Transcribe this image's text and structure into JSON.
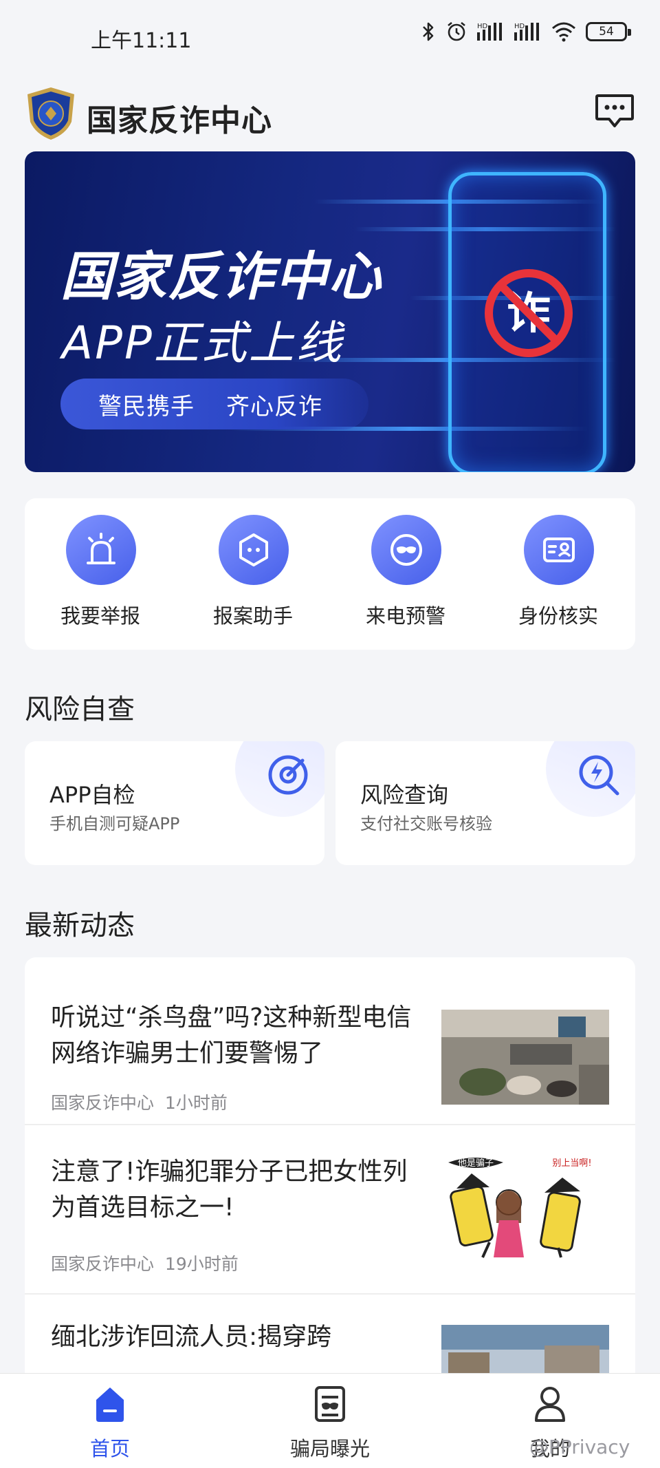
{
  "status_bar": {
    "time": "上午11:11",
    "battery": "54"
  },
  "header": {
    "title": "国家反诈中心"
  },
  "banner": {
    "title": "国家反诈中心",
    "subtitle": "APP正式上线",
    "slogan_1": "警民携手",
    "slogan_2": "齐心反诈",
    "badge_char": "诈"
  },
  "quick_actions": [
    {
      "label": "我要举报",
      "icon": "alarm-light-icon"
    },
    {
      "label": "报案助手",
      "icon": "robot-face-icon"
    },
    {
      "label": "来电预警",
      "icon": "mask-icon"
    },
    {
      "label": "身份核实",
      "icon": "id-card-icon"
    }
  ],
  "risk_section": {
    "title": "风险自查",
    "cards": [
      {
        "title": "APP自检",
        "subtitle": "手机自测可疑APP",
        "icon": "target-scan-icon"
      },
      {
        "title": "风险查询",
        "subtitle": "支付社交账号核验",
        "icon": "search-bolt-icon"
      }
    ]
  },
  "news_section": {
    "title": "最新动态",
    "items": [
      {
        "title": "听说过“杀鸟盘”吗?这种新型电信网络诈骗男士们要警惕了",
        "source": "国家反诈中心",
        "time": "1小时前"
      },
      {
        "title": "注意了!诈骗犯罪分子已把女性列为首选目标之一!",
        "source": "国家反诈中心",
        "time": "19小时前"
      },
      {
        "title": "缅北涉诈回流人员:揭穿跨",
        "source": "",
        "time": ""
      }
    ],
    "cartoon_text_1": "他是骗子",
    "cartoon_text_2": "别上当啊!"
  },
  "tabbar": {
    "tabs": [
      {
        "label": "首页",
        "icon": "home-icon",
        "active": true
      },
      {
        "label": "骗局曝光",
        "icon": "exposure-book-icon",
        "active": false
      },
      {
        "label": "我的",
        "icon": "user-icon",
        "active": false
      }
    ]
  },
  "watermark": "@PPrivacy",
  "colors": {
    "accent": "#2f54eb",
    "banner_bg": "#14277f",
    "page_bg": "#f4f5f8"
  }
}
